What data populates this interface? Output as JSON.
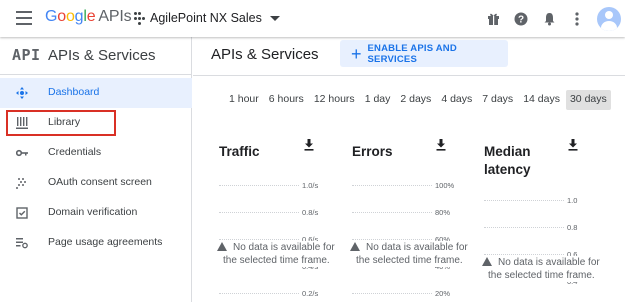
{
  "header": {
    "logo_letters": [
      "G",
      "o",
      "o",
      "g",
      "l",
      "e"
    ],
    "logo_suffix": "APIs",
    "project_name": "AgilePoint NX Sales",
    "icons": [
      "menu-icon",
      "gift-icon",
      "help-icon",
      "notifications-icon",
      "more-vert-icon",
      "account-avatar-icon"
    ]
  },
  "sidebar": {
    "api_glyph": "API",
    "title": "APIs & Services",
    "items": [
      {
        "label": "Dashboard",
        "icon": "dashboard-icon",
        "active": true
      },
      {
        "label": "Library",
        "icon": "library-icon",
        "active": false
      },
      {
        "label": "Credentials",
        "icon": "key-icon",
        "active": false
      },
      {
        "label": "OAuth consent screen",
        "icon": "consent-icon",
        "active": false
      },
      {
        "label": "Domain verification",
        "icon": "checkbox-icon",
        "active": false
      },
      {
        "label": "Page usage agreements",
        "icon": "settings-list-icon",
        "active": false
      }
    ]
  },
  "main": {
    "title": "APIs & Services",
    "enable_button": "ENABLE APIS AND SERVICES",
    "time_ranges": [
      "1 hour",
      "6 hours",
      "12 hours",
      "1 day",
      "2 days",
      "4 days",
      "7 days",
      "14 days",
      "30 days"
    ],
    "selected_range": "30 days",
    "cards": [
      {
        "title": "Traffic",
        "ticks": [
          "1.0/s",
          "0.8/s",
          "0.6/s",
          "0.4/s",
          "0.2/s"
        ],
        "nodata_1": "No data is available for",
        "nodata_2": "the selected time frame."
      },
      {
        "title": "Errors",
        "ticks": [
          "100%",
          "80%",
          "60%",
          "40%",
          "20%"
        ],
        "nodata_1": "No data is available for",
        "nodata_2": "the selected time frame."
      },
      {
        "title_1": "Median",
        "title_2": "latency",
        "ticks": [
          "1.0",
          "0.8",
          "0.6",
          "0.4"
        ],
        "nodata_1": "No data is available for",
        "nodata_2": "the selected time frame."
      }
    ]
  },
  "colors": {
    "accent": "#1a73e8",
    "active_bg": "#e8f0fe",
    "highlight": "#d93025"
  }
}
